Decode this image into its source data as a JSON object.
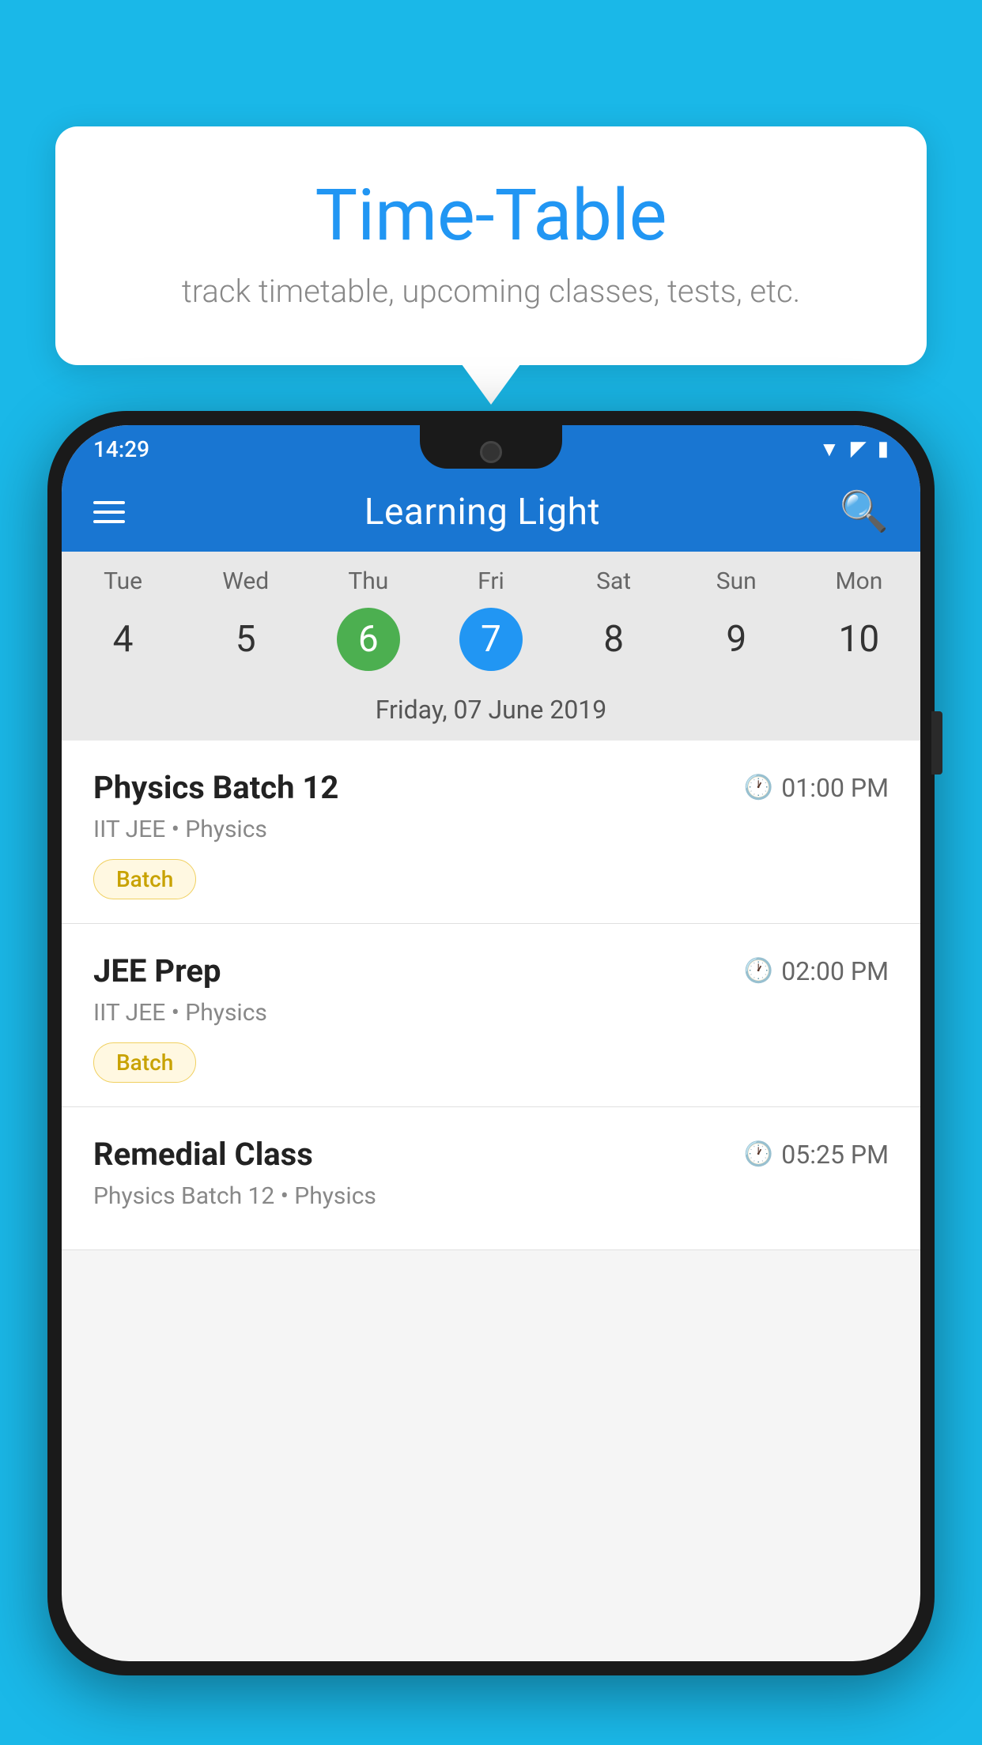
{
  "page": {
    "background_color": "#1ab8e8"
  },
  "tooltip": {
    "title": "Time-Table",
    "subtitle": "track timetable, upcoming classes, tests, etc."
  },
  "phone": {
    "status_bar": {
      "time": "14:29"
    },
    "app_header": {
      "title": "Learning Light"
    },
    "calendar": {
      "days": [
        {
          "name": "Tue",
          "num": "4",
          "style": "normal"
        },
        {
          "name": "Wed",
          "num": "5",
          "style": "normal"
        },
        {
          "name": "Thu",
          "num": "6",
          "style": "green"
        },
        {
          "name": "Fri",
          "num": "7",
          "style": "blue"
        },
        {
          "name": "Sat",
          "num": "8",
          "style": "normal"
        },
        {
          "name": "Sun",
          "num": "9",
          "style": "normal"
        },
        {
          "name": "Mon",
          "num": "10",
          "style": "normal"
        }
      ],
      "selected_date": "Friday, 07 June 2019"
    },
    "classes": [
      {
        "name": "Physics Batch 12",
        "time": "01:00 PM",
        "subtitle": "IIT JEE • Physics",
        "badge": "Batch"
      },
      {
        "name": "JEE Prep",
        "time": "02:00 PM",
        "subtitle": "IIT JEE • Physics",
        "badge": "Batch"
      },
      {
        "name": "Remedial Class",
        "time": "05:25 PM",
        "subtitle": "Physics Batch 12 • Physics",
        "badge": ""
      }
    ]
  }
}
